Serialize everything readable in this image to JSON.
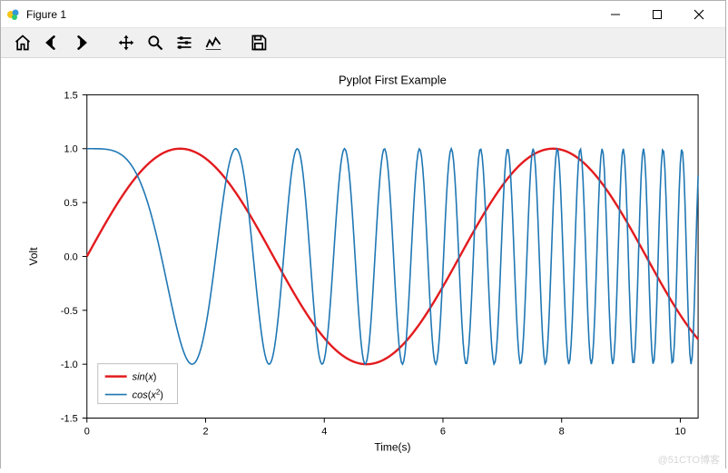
{
  "window": {
    "title": "Figure 1"
  },
  "toolbar": {
    "home": "Home",
    "back": "Back",
    "forward": "Forward",
    "pan": "Pan",
    "zoom": "Zoom",
    "subplots": "Configure subplots",
    "edit": "Edit plot",
    "save": "Save"
  },
  "watermark": "@51CTO博客",
  "chart_data": {
    "type": "line",
    "title": "Pyplot First Example",
    "xlabel": "Time(s)",
    "ylabel": "Volt",
    "xlim": [
      0,
      10.3
    ],
    "ylim": [
      -1.5,
      1.5
    ],
    "xticks": [
      0,
      2,
      4,
      6,
      8,
      10
    ],
    "yticks": [
      -1.5,
      -1.0,
      -0.5,
      0.0,
      0.5,
      1.0,
      1.5
    ],
    "x_step": 0.02,
    "series": [
      {
        "name": "sin(x)",
        "color": "#e31b1e",
        "linewidth": 2.4,
        "func": "sin(x)"
      },
      {
        "name": "cos(x^2)",
        "color": "#1f77b4",
        "linewidth": 1.6,
        "func": "cos(x^2)"
      }
    ],
    "legend": {
      "loc": "lower left",
      "items": [
        "sin(x)",
        "cos(x²)"
      ]
    }
  }
}
